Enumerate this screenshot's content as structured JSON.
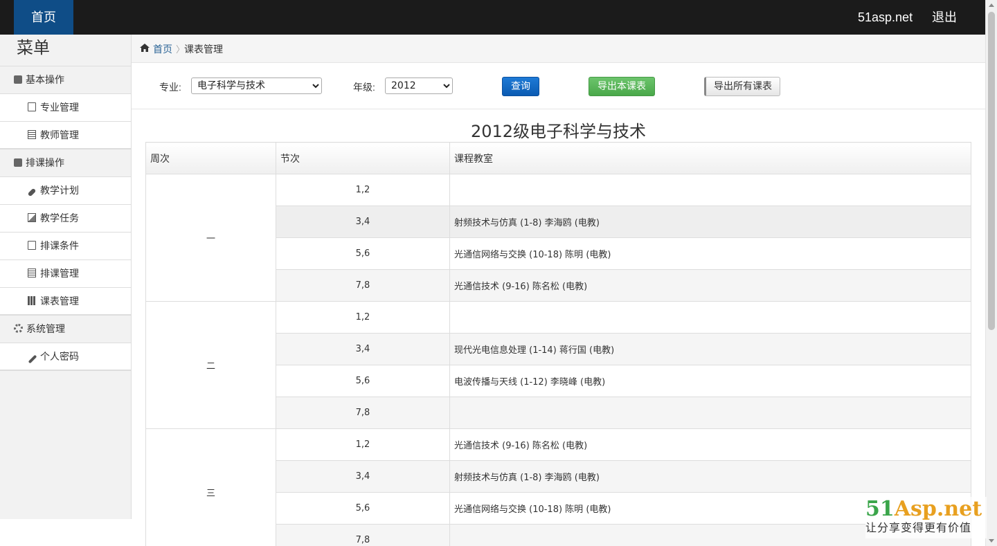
{
  "topbar": {
    "home": "首页",
    "site": "51asp.net",
    "logout": "退出"
  },
  "sidebar": {
    "title": "菜单",
    "groups": [
      {
        "label": "基本操作",
        "items": [
          "专业管理",
          "教师管理"
        ]
      },
      {
        "label": "排课操作",
        "items": [
          "教学计划",
          "教学任务",
          "排课条件",
          "排课管理",
          "课表管理"
        ]
      },
      {
        "label": "系统管理",
        "items": [
          "个人密码"
        ]
      }
    ]
  },
  "breadcrumb": {
    "home": "首页",
    "separator": "〉",
    "current": "课表管理"
  },
  "filter": {
    "major_label": "专业:",
    "major_value": "电子科学与技术",
    "grade_label": "年级:",
    "grade_value": "2012",
    "query_button": "查询",
    "export_this": "导出本课表",
    "export_all": "导出所有课表"
  },
  "schedule": {
    "title": "2012级电子科学与技术",
    "headers": [
      "周次",
      "节次",
      "课程教室"
    ],
    "weeks": [
      {
        "day": "一",
        "rows": [
          {
            "period": "1,2",
            "course": ""
          },
          {
            "period": "3,4",
            "course": "射频技术与仿真 (1-8) 李海鸥 (电教)"
          },
          {
            "period": "5,6",
            "course": "光通信网络与交换 (10-18) 陈明 (电教)"
          },
          {
            "period": "7,8",
            "course": "光通信技术 (9-16) 陈名松 (电教)"
          }
        ]
      },
      {
        "day": "二",
        "rows": [
          {
            "period": "1,2",
            "course": ""
          },
          {
            "period": "3,4",
            "course": "现代光电信息处理 (1-14) 蒋行国 (电教)"
          },
          {
            "period": "5,6",
            "course": "电波传播与天线 (1-12) 李晓峰 (电教)"
          },
          {
            "period": "7,8",
            "course": ""
          }
        ]
      },
      {
        "day": "三",
        "rows": [
          {
            "period": "1,2",
            "course": "光通信技术 (9-16) 陈名松 (电教)"
          },
          {
            "period": "3,4",
            "course": "射频技术与仿真 (1-8) 李海鸥 (电教)"
          },
          {
            "period": "5,6",
            "course": "光通信网络与交换 (10-18) 陈明 (电教)"
          },
          {
            "period": "7,8",
            "course": ""
          }
        ]
      }
    ]
  },
  "watermark": {
    "brand_a": "51",
    "brand_b": "Asp.net",
    "slogan": "让分享变得更有价值"
  }
}
